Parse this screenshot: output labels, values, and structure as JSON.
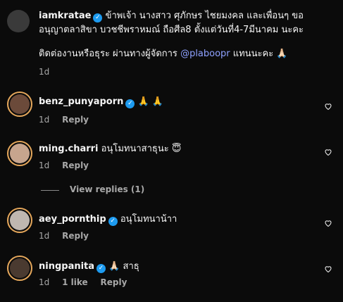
{
  "caption": {
    "username": "iamkratae",
    "text_line1": "ข้าพเจ้า นางสาว ศุภักษร ไชยมงคล และเพื่อนๆ ขอ",
    "text_line2": "อนุญาตลาสิขา บวชชีพราหมณ์ ถือศีล8 ตั้งแต่วันที่4-7มีนาคม นะคะ",
    "text_line3_prefix": "ติดต่องานหรือธุระ ผ่านทางผู้จัดการ",
    "mention": "@plaboopr",
    "text_line3_suffix": "แทนนะคะ",
    "emoji": "🙏🏻",
    "time": "1d"
  },
  "comments": [
    {
      "username": "benz_punyaporn",
      "verified": true,
      "text": "🙏 🙏",
      "time": "1d",
      "reply_label": "Reply",
      "likes": ""
    },
    {
      "username": "ming.charri",
      "verified": false,
      "text": "อนุโมทนาสาธุนะ 😇",
      "time": "1d",
      "reply_label": "Reply",
      "likes": ""
    },
    {
      "username": "aey_pornthip",
      "verified": true,
      "text": "อนุโมทนาน้าา",
      "time": "1d",
      "reply_label": "Reply",
      "likes": ""
    },
    {
      "username": "ningpanita",
      "verified": true,
      "text": "🙏🏻 สาธุ",
      "time": "1d",
      "reply_label": "Reply",
      "likes": "1 like"
    }
  ],
  "view_replies_label": "View replies (1)",
  "colors": {
    "background": "#0b0b0b",
    "verified": "#1d9bf0",
    "mention": "#8ea1ff",
    "ring": "#e6a85c"
  }
}
